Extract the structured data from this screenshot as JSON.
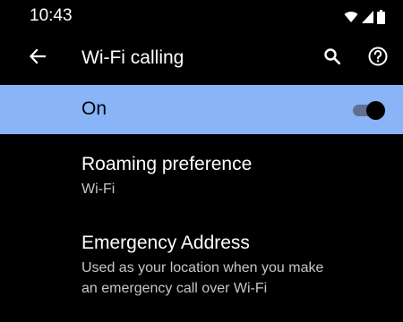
{
  "status_bar": {
    "time": "10:43",
    "icons": [
      "wifi-icon",
      "cell-signal-icon",
      "battery-icon"
    ]
  },
  "app_bar": {
    "title": "Wi-Fi calling",
    "icons": [
      "back-arrow-icon",
      "search-icon",
      "help-icon"
    ]
  },
  "master_switch": {
    "label": "On",
    "checked": true,
    "highlight_color": "#8ab4f8"
  },
  "preferences": [
    {
      "title": "Roaming preference",
      "summary": "Wi-Fi"
    },
    {
      "title": "Emergency Address",
      "summary_line1": "Used as your location when you make",
      "summary_line2": "an emergency call over Wi-Fi"
    }
  ]
}
